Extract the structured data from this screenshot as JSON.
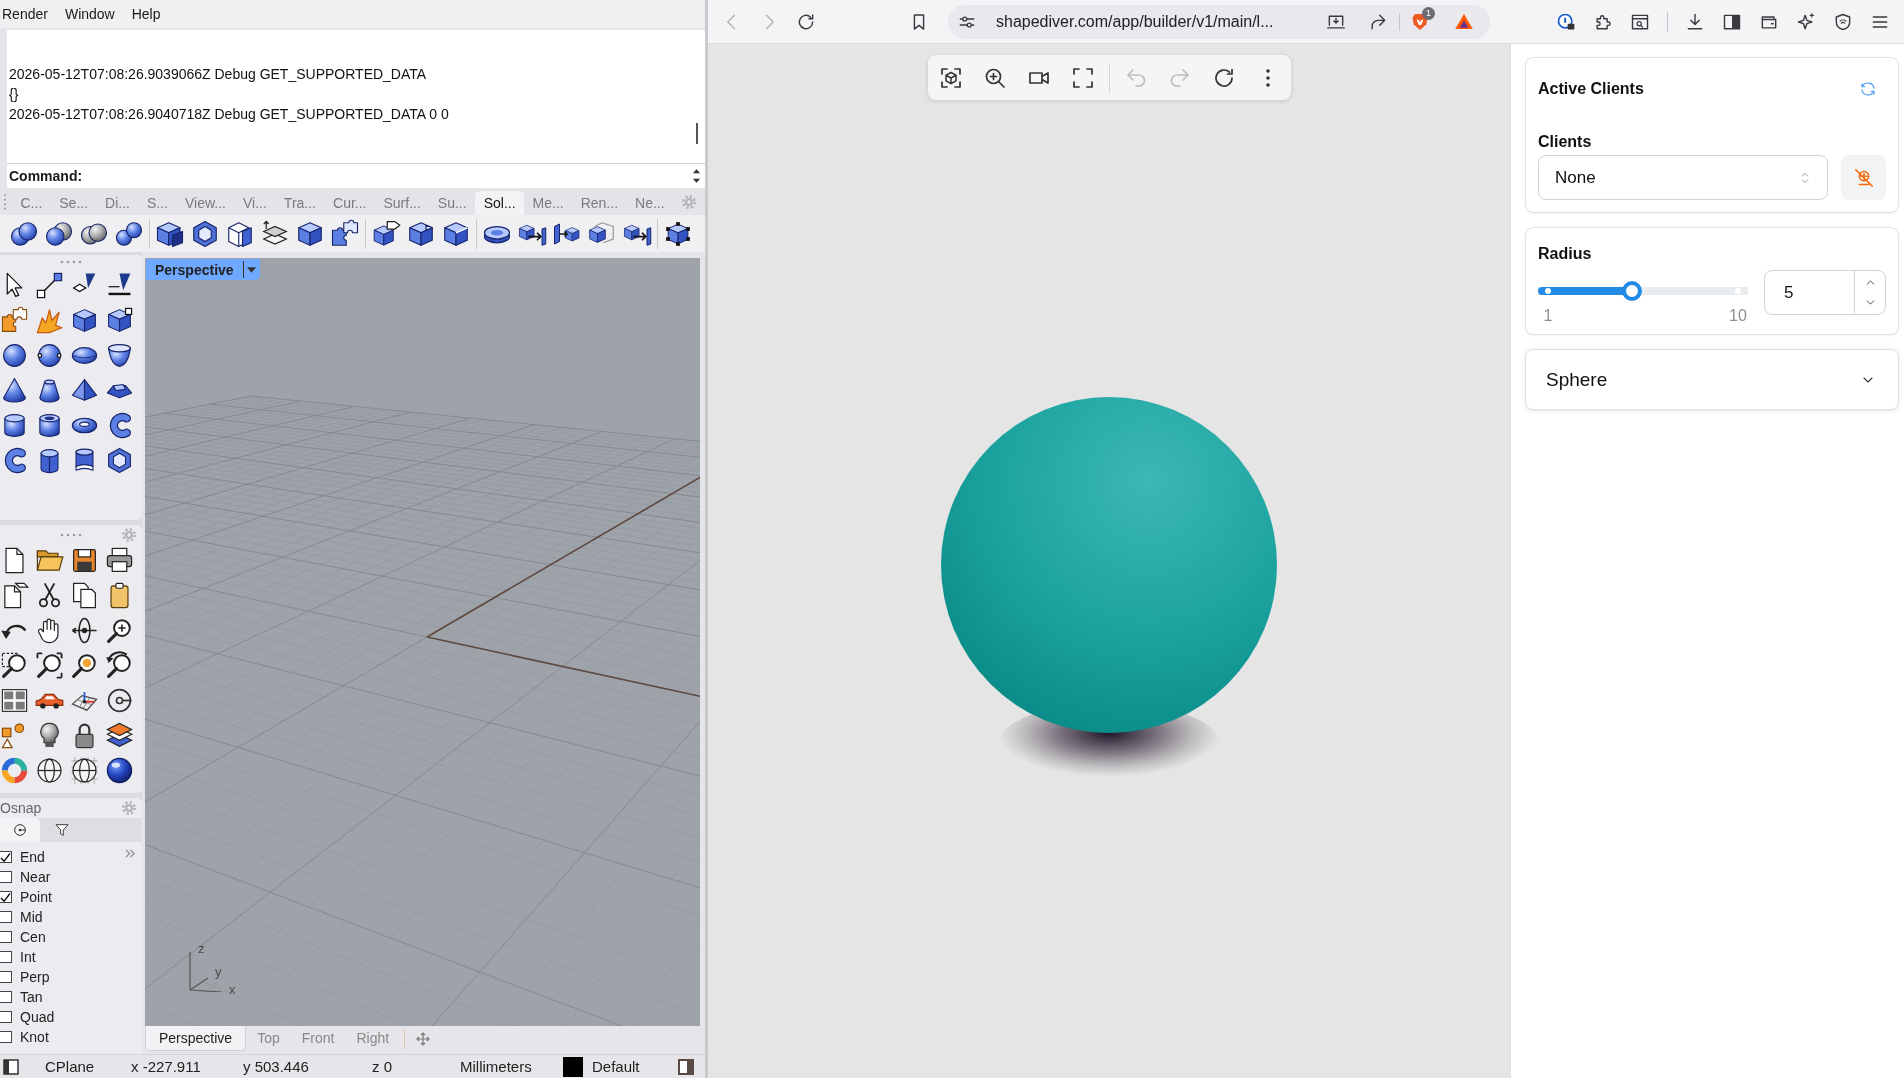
{
  "rhino": {
    "menu": [
      "Render",
      "Window",
      "Help"
    ],
    "command_history": [
      "2026-05-12T07:08:26.9039066Z Debug GET_SUPPORTED_DATA",
      "{}",
      "2026-05-12T07:08:26.9040718Z Debug GET_SUPPORTED_DATA 0 0"
    ],
    "command_prompt": "Command:",
    "toolbar_tabs": [
      {
        "label": "C...",
        "selected": false
      },
      {
        "label": "Se...",
        "selected": false
      },
      {
        "label": "Di...",
        "selected": false
      },
      {
        "label": "S...",
        "selected": false
      },
      {
        "label": "View...",
        "selected": false
      },
      {
        "label": "Vi...",
        "selected": false
      },
      {
        "label": "Tra...",
        "selected": false
      },
      {
        "label": "Cur...",
        "selected": false
      },
      {
        "label": "Surf...",
        "selected": false
      },
      {
        "label": "Su...",
        "selected": false
      },
      {
        "label": "Sol...",
        "selected": true
      },
      {
        "label": "Me...",
        "selected": false
      },
      {
        "label": "Ren...",
        "selected": false
      },
      {
        "label": "Ne...",
        "selected": false
      }
    ],
    "osnap": {
      "title": "Osnap",
      "tabs": [
        {
          "kind": "snap",
          "selected": true
        },
        {
          "kind": "filter",
          "selected": false
        }
      ],
      "items": [
        {
          "label": "End",
          "checked": true
        },
        {
          "label": "Near",
          "checked": false
        },
        {
          "label": "Point",
          "checked": true
        },
        {
          "label": "Mid",
          "checked": false
        },
        {
          "label": "Cen",
          "checked": false
        },
        {
          "label": "Int",
          "checked": false
        },
        {
          "label": "Perp",
          "checked": false
        },
        {
          "label": "Tan",
          "checked": false
        },
        {
          "label": "Quad",
          "checked": false
        },
        {
          "label": "Knot",
          "checked": false
        }
      ]
    },
    "viewport": {
      "title": "Perspective",
      "axis_labels": [
        "z",
        "y",
        "x"
      ]
    },
    "viewport_tabs": [
      {
        "label": "Perspective",
        "selected": true
      },
      {
        "label": "Top",
        "selected": false
      },
      {
        "label": "Front",
        "selected": false
      },
      {
        "label": "Right",
        "selected": false
      }
    ],
    "status_bar": {
      "cplane": "CPlane",
      "x": "x -227.911",
      "y": "y 503.446",
      "z": "z 0",
      "units": "Millimeters",
      "layer": "Default"
    }
  },
  "browser": {
    "nav_buttons": [
      {
        "kind": "back",
        "disabled": true
      },
      {
        "kind": "forward",
        "disabled": true
      },
      {
        "kind": "reload",
        "disabled": false
      }
    ],
    "address": "shapediver.com/app/builder/v1/main/l...",
    "shields_badge": "1",
    "viewer": {
      "toolbar": [
        {
          "kind": "focus",
          "disabled": false
        },
        {
          "kind": "zoom",
          "disabled": false
        },
        {
          "kind": "camera",
          "disabled": false
        },
        {
          "kind": "fullscreen",
          "disabled": false
        },
        {
          "kind": "undo",
          "disabled": true
        },
        {
          "kind": "redo",
          "disabled": true
        },
        {
          "kind": "reload",
          "disabled": false
        },
        {
          "kind": "more",
          "disabled": false
        }
      ]
    },
    "panel": {
      "active_clients": {
        "title": "Active Clients",
        "field_label": "Clients",
        "value": "None"
      },
      "radius": {
        "label": "Radius",
        "level": 0.444,
        "min": "1",
        "max": "10",
        "value": "5"
      },
      "sphere": {
        "title": "Sphere",
        "expanded": false
      }
    }
  }
}
